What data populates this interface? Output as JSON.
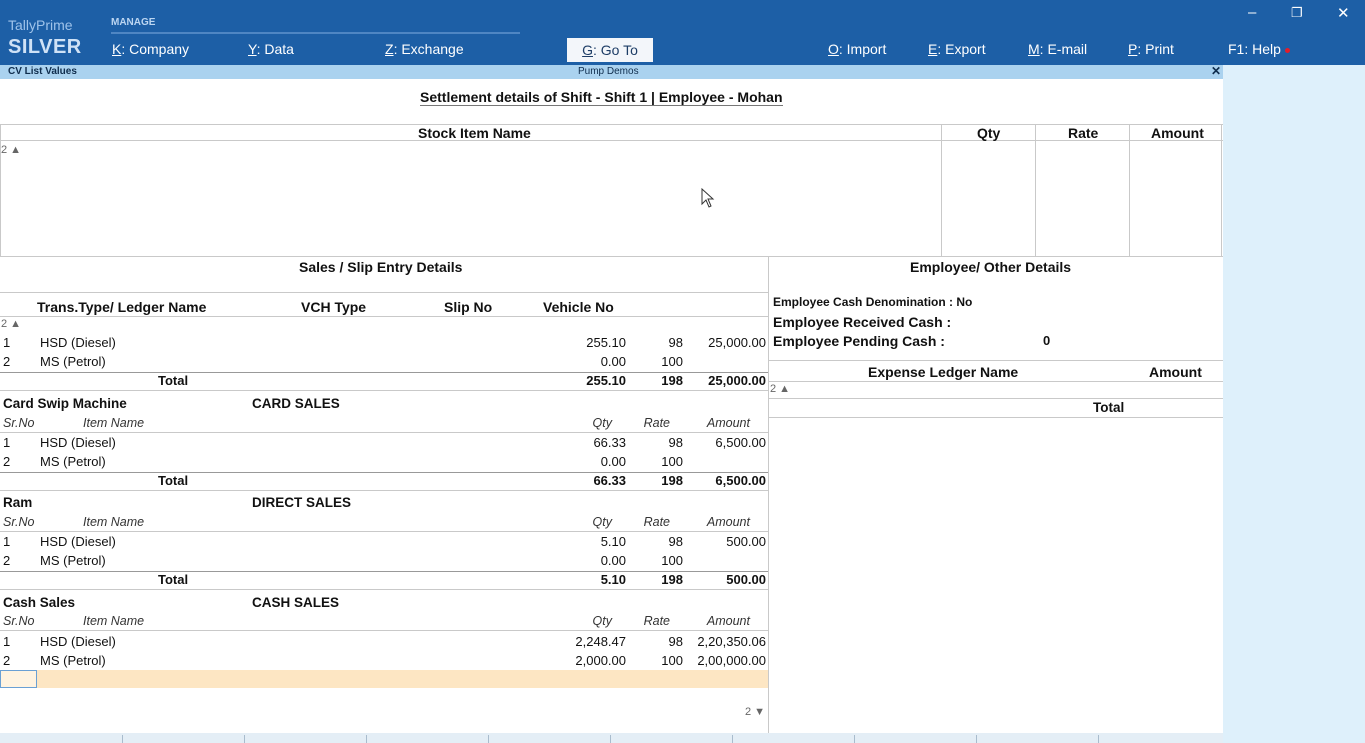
{
  "brand": {
    "line1": "TallyPrime",
    "line2": "SILVER"
  },
  "manage_label": "MANAGE",
  "menu": {
    "company": {
      "key": "K",
      "label": ": Company"
    },
    "data": {
      "key": "Y",
      "label": ": Data"
    },
    "exchange": {
      "key": "Z",
      "label": ": Exchange"
    },
    "goto": {
      "key": "G",
      "label": ": Go To"
    },
    "import": {
      "key": "O",
      "label": ": Import"
    },
    "export": {
      "key": "E",
      "label": ": Export"
    },
    "email": {
      "key": "M",
      "label": ": E-mail"
    },
    "print": {
      "key": "P",
      "label": ": Print"
    },
    "help": {
      "key": "F1",
      "label": ": Help"
    }
  },
  "window": {
    "minimize": "–",
    "restore": "❐",
    "close": "✕"
  },
  "subbar": {
    "left": "CV List Values",
    "center": "Pump Demos",
    "close": "✕"
  },
  "report_title": "Settlement details of Shift - Shift 1 | Employee - Mohan",
  "stock": {
    "headers": {
      "name": "Stock Item Name",
      "qty": "Qty",
      "rate": "Rate",
      "amount": "Amount"
    },
    "marker": "2 ▲"
  },
  "sales": {
    "section_title": "Sales / Slip Entry Details",
    "headers": {
      "ledger": "Trans.Type/ Ledger Name",
      "vch": "VCH Type",
      "slip": "Slip No",
      "vehicle": "Vehicle No"
    },
    "marker": "2 ▲",
    "summary": {
      "rows": [
        {
          "sr": "1",
          "item": "HSD (Diesel)",
          "qty": "255.10",
          "rate": "98",
          "amount": "25,000.00"
        },
        {
          "sr": "2",
          "item": "MS (Petrol)",
          "qty": "0.00",
          "rate": "100",
          "amount": ""
        }
      ],
      "total": {
        "label": "Total",
        "qty": "255.10",
        "rate": "198",
        "amount": "25,000.00"
      }
    },
    "col_headers": {
      "sr": "Sr.No",
      "item": "Item Name",
      "qty": "Qty",
      "rate": "Rate",
      "amount": "Amount"
    },
    "groups": [
      {
        "ledger": "Card Swip Machine",
        "vch": "CARD SALES",
        "rows": [
          {
            "sr": "1",
            "item": "HSD (Diesel)",
            "qty": "66.33",
            "rate": "98",
            "amount": "6,500.00"
          },
          {
            "sr": "2",
            "item": "MS (Petrol)",
            "qty": "0.00",
            "rate": "100",
            "amount": ""
          }
        ],
        "total": {
          "label": "Total",
          "qty": "66.33",
          "rate": "198",
          "amount": "6,500.00"
        }
      },
      {
        "ledger": "Ram",
        "vch": "DIRECT SALES",
        "rows": [
          {
            "sr": "1",
            "item": "HSD (Diesel)",
            "qty": "5.10",
            "rate": "98",
            "amount": "500.00"
          },
          {
            "sr": "2",
            "item": "MS (Petrol)",
            "qty": "0.00",
            "rate": "100",
            "amount": ""
          }
        ],
        "total": {
          "label": "Total",
          "qty": "5.10",
          "rate": "198",
          "amount": "500.00"
        }
      },
      {
        "ledger": "Cash Sales",
        "vch": "CASH SALES",
        "rows": [
          {
            "sr": "1",
            "item": "HSD (Diesel)",
            "qty": "2,248.47",
            "rate": "98",
            "amount": "2,20,350.06"
          },
          {
            "sr": "2",
            "item": "MS (Petrol)",
            "qty": "2,000.00",
            "rate": "100",
            "amount": "2,00,000.00"
          }
        ]
      }
    ],
    "footer_marker": "2 ▼"
  },
  "employee": {
    "section_title": "Employee/ Other Details",
    "cash_denomination_label": "Employee Cash Denomination : No",
    "received_label": "Employee Received Cash :",
    "pending_label": "Employee Pending Cash   :",
    "pending_value": "0",
    "expense": {
      "headers": {
        "name": "Expense Ledger Name",
        "amount": "Amount"
      },
      "marker": "2 ▲",
      "total_label": "Total"
    }
  },
  "colors": {
    "topbar": "#1d5fa6",
    "subbar": "#aad2ef",
    "selection": "#fde6c3"
  }
}
